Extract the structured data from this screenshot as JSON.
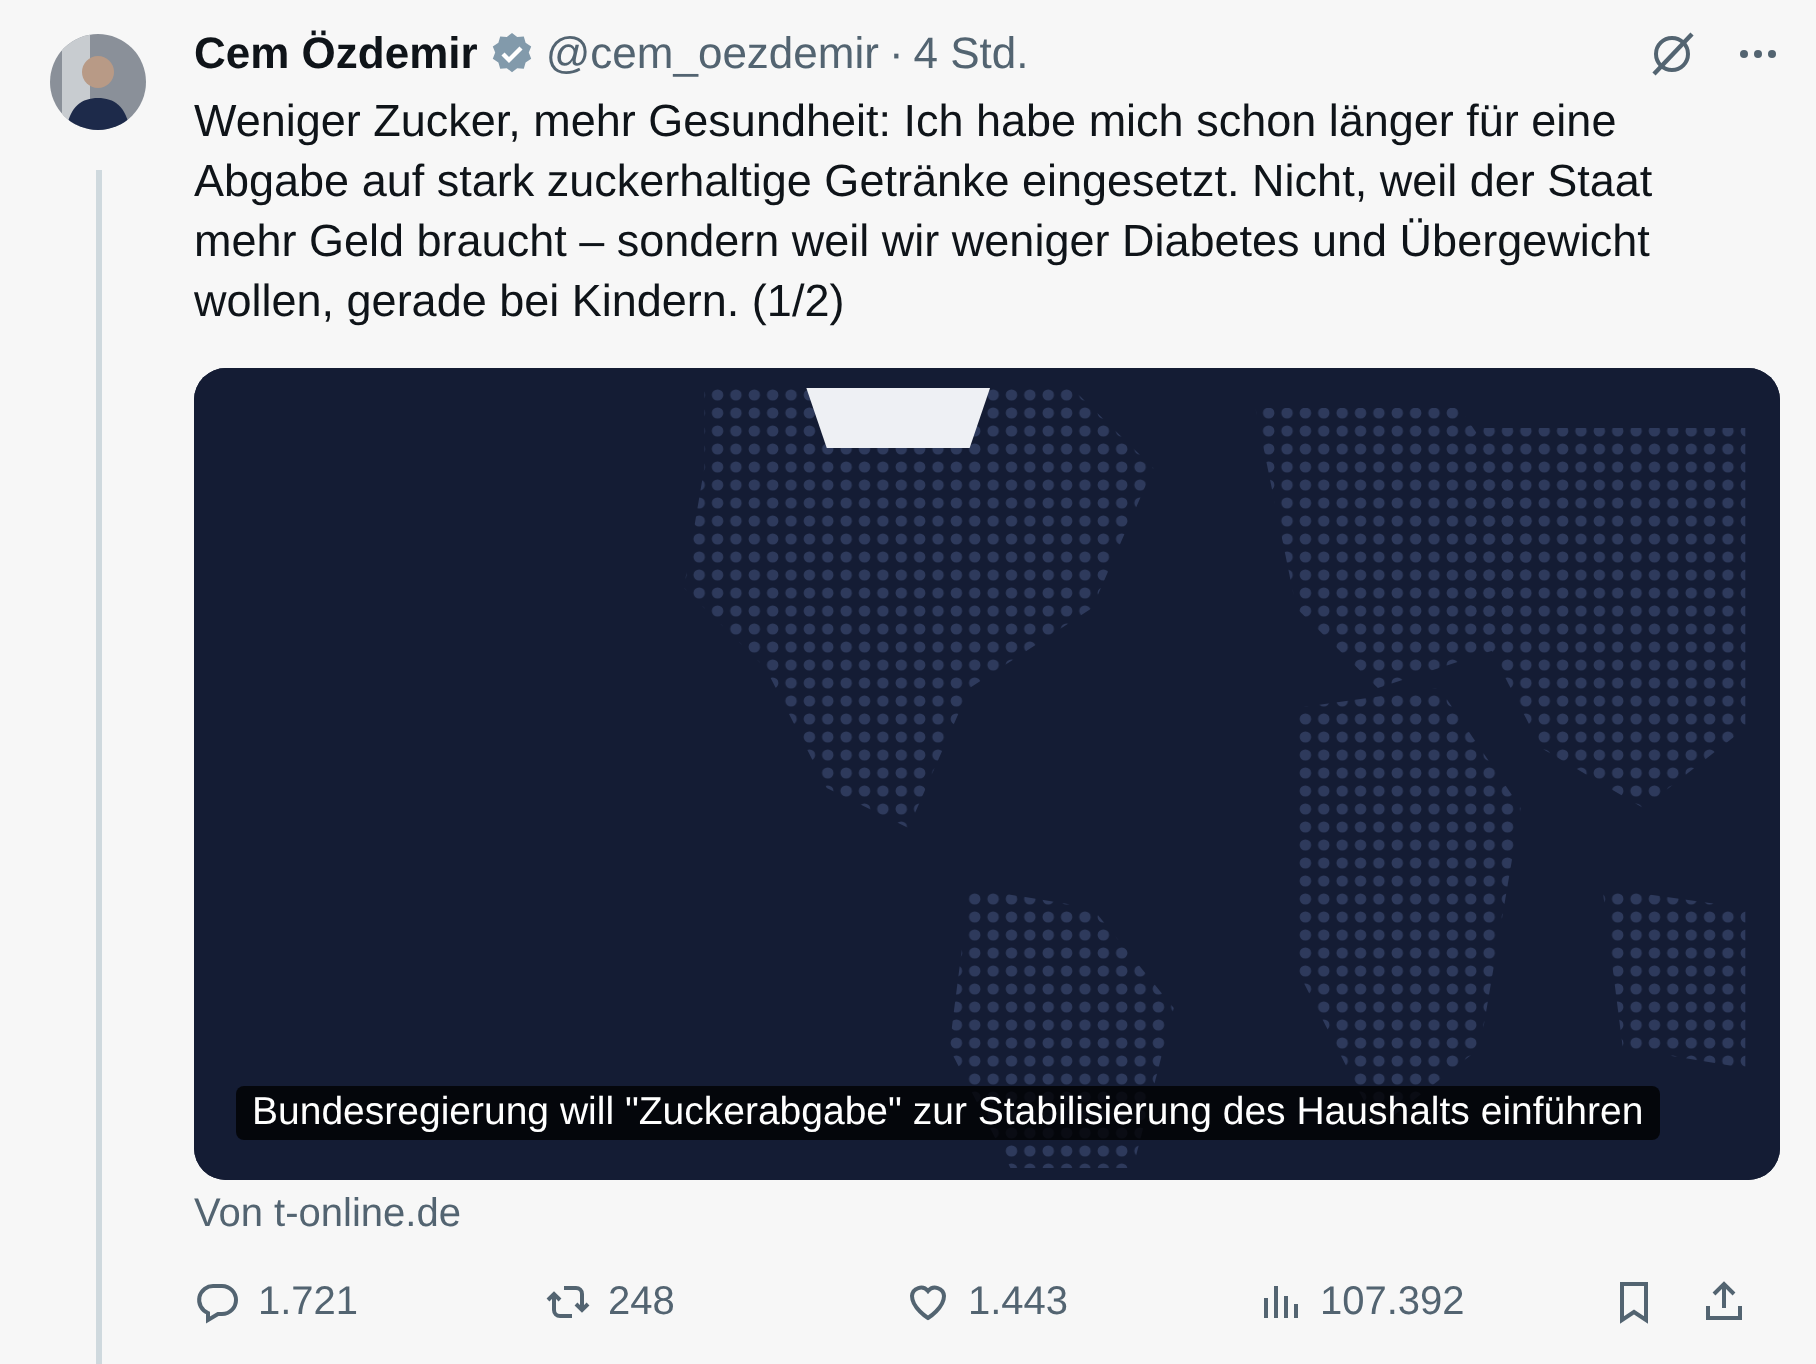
{
  "tweet": {
    "author": {
      "name": "Cem Özdemir",
      "verified": true,
      "handle": "@cem_oezdemir",
      "separator": "·",
      "time": "4 Std."
    },
    "text": "Weniger Zucker, mehr Gesundheit: Ich habe mich schon länger für eine Abgabe auf stark zuckerhaltige Getränke eingesetzt. Nicht, weil der Staat mehr Geld braucht – sondern weil wir weniger Diabetes und Übergewicht wollen, gerade bei Kindern. (1/2)",
    "card": {
      "kind": "picture",
      "title": "Bundesregierung will \"Zuckerabgabe\" zur Stabilisierung des Haushalts einführen",
      "source": "Von t-online.de"
    },
    "actions": [
      {
        "kind": "reply",
        "count": "1.721"
      },
      {
        "kind": "repost",
        "count": "248"
      },
      {
        "kind": "like",
        "count": "1.443"
      },
      {
        "kind": "views",
        "count": "107.392"
      },
      {
        "kind": "bookmark"
      },
      {
        "kind": "share"
      }
    ]
  }
}
